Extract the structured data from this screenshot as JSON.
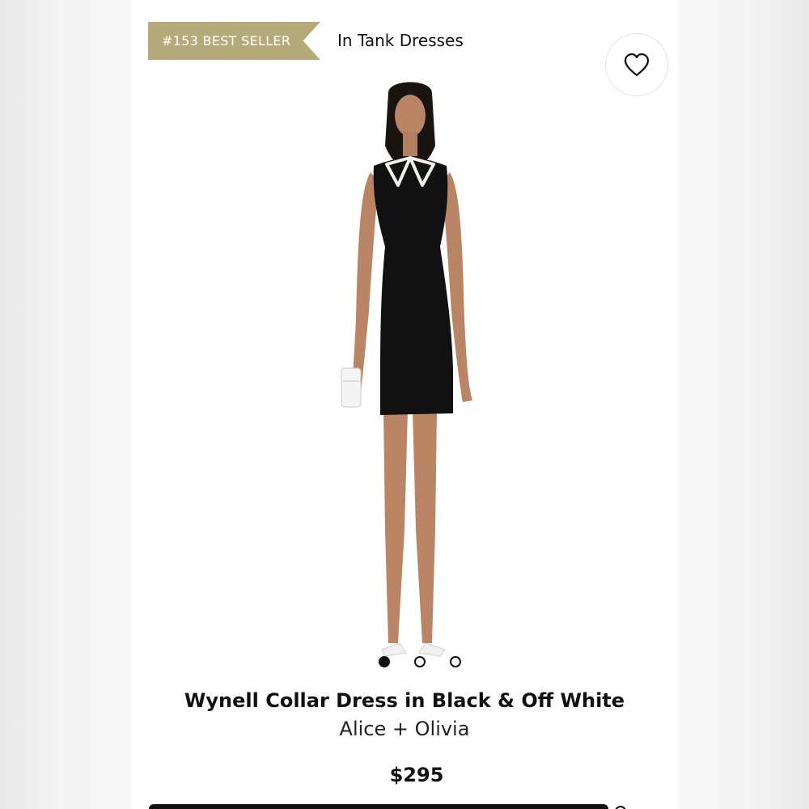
{
  "badge": {
    "label": "#153 BEST SELLER"
  },
  "category": {
    "label": "In Tank Dresses"
  },
  "wishlist": {
    "icon": "heart-icon"
  },
  "product": {
    "title": "Wynell Collar Dress in Black & Off White",
    "brand": "Alice + Olivia",
    "price": "$295"
  },
  "carousel": {
    "total_images": 3,
    "active_index": 0
  },
  "colors": {
    "badge": "#b5aa7a",
    "dress": "#111111",
    "collar": "#f2f0ea"
  }
}
